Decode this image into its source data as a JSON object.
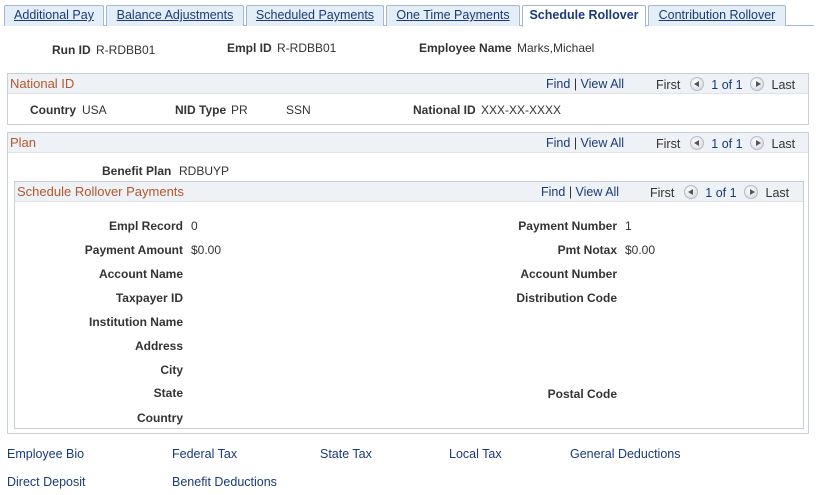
{
  "tabs": [
    "Additional Pay",
    "Balance Adjustments",
    "Scheduled Payments",
    "One Time Payments",
    "Schedule Rollover",
    "Contribution Rollover"
  ],
  "header": {
    "run_id_label": "Run ID",
    "run_id": "R-RDBB01",
    "empl_id_label": "Empl ID",
    "empl_id": "R-RDBB01",
    "employee_name_label": "Employee Name",
    "employee_name": "Marks,Michael"
  },
  "national_id": {
    "title": "National ID",
    "country_label": "Country",
    "country": "USA",
    "nid_type_label": "NID Type",
    "nid_type": "PR",
    "nid_type_desc": "SSN",
    "national_id_label": "National ID",
    "national_id": "XXX-XX-XXXX"
  },
  "plan": {
    "title": "Plan",
    "benefit_plan_label": "Benefit Plan",
    "benefit_plan": "RDBUYP"
  },
  "rollover": {
    "title": "Schedule Rollover Payments",
    "empl_record_label": "Empl Record",
    "empl_record": "0",
    "payment_number_label": "Payment Number",
    "payment_number": "1",
    "payment_amount_label": "Payment Amount",
    "payment_amount": "$0.00",
    "pmt_notax_label": "Pmt Notax",
    "pmt_notax": "$0.00",
    "account_name_label": "Account Name",
    "account_number_label": "Account Number",
    "taxpayer_id_label": "Taxpayer ID",
    "distribution_code_label": "Distribution Code",
    "institution_name_label": "Institution Name",
    "address_label": "Address",
    "city_label": "City",
    "state_label": "State",
    "postal_code_label": "Postal Code",
    "country_label": "Country"
  },
  "nav": {
    "find": "Find",
    "sep": "|",
    "view_all": "View All",
    "first": "First",
    "count": "1 of 1",
    "last": "Last"
  },
  "footer": [
    "Employee Bio",
    "Federal Tax",
    "State Tax",
    "Local Tax",
    "General Deductions",
    "Direct Deposit",
    "Benefit Deductions"
  ]
}
